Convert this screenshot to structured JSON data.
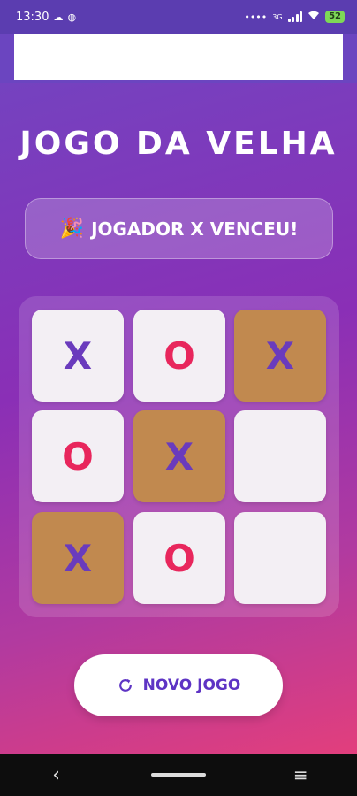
{
  "status_bar": {
    "time": "13:30",
    "network_label": "3G",
    "battery": "52",
    "icons": [
      "cloud-icon",
      "globe-icon",
      "dots-icon",
      "signal-icon",
      "wifi-icon",
      "battery-icon"
    ]
  },
  "title": "JOGO DA VELHA",
  "winner": {
    "icon": "🎉",
    "text": "JOGADOR X VENCEU!"
  },
  "board": {
    "cells": [
      "X",
      "O",
      "X",
      "O",
      "X",
      "",
      "X",
      "O",
      ""
    ],
    "winning_cells": [
      2,
      4,
      6
    ]
  },
  "new_game": {
    "label": "NOVO JOGO",
    "icon": "refresh-icon"
  },
  "nav": {
    "back": "‹",
    "menu": "≡"
  },
  "colors": {
    "x": "#6a3bbd",
    "o": "#e8265c",
    "win_cell": "#c1894f",
    "cell": "#f3eff4",
    "button_text": "#5e34c4"
  }
}
